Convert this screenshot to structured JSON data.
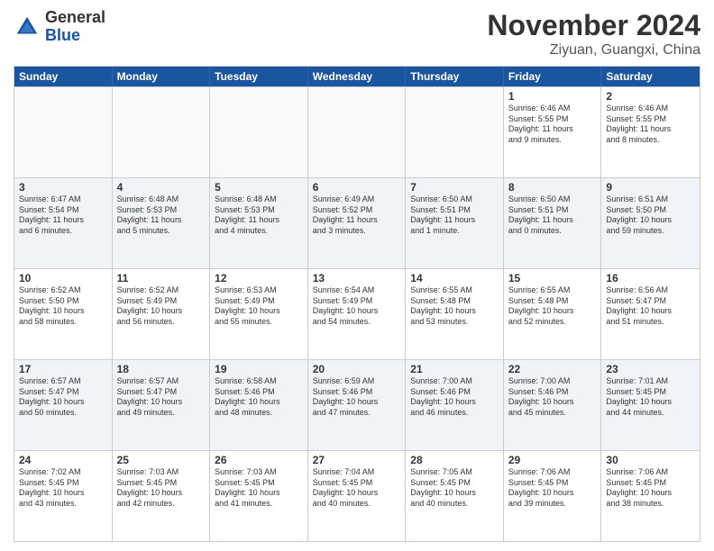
{
  "logo": {
    "line1": "General",
    "line2": "Blue"
  },
  "title": "November 2024",
  "location": "Ziyuan, Guangxi, China",
  "headers": [
    "Sunday",
    "Monday",
    "Tuesday",
    "Wednesday",
    "Thursday",
    "Friday",
    "Saturday"
  ],
  "rows": [
    [
      {
        "day": "",
        "info": ""
      },
      {
        "day": "",
        "info": ""
      },
      {
        "day": "",
        "info": ""
      },
      {
        "day": "",
        "info": ""
      },
      {
        "day": "",
        "info": ""
      },
      {
        "day": "1",
        "info": "Sunrise: 6:46 AM\nSunset: 5:55 PM\nDaylight: 11 hours\nand 9 minutes."
      },
      {
        "day": "2",
        "info": "Sunrise: 6:46 AM\nSunset: 5:55 PM\nDaylight: 11 hours\nand 8 minutes."
      }
    ],
    [
      {
        "day": "3",
        "info": "Sunrise: 6:47 AM\nSunset: 5:54 PM\nDaylight: 11 hours\nand 6 minutes."
      },
      {
        "day": "4",
        "info": "Sunrise: 6:48 AM\nSunset: 5:53 PM\nDaylight: 11 hours\nand 5 minutes."
      },
      {
        "day": "5",
        "info": "Sunrise: 6:48 AM\nSunset: 5:53 PM\nDaylight: 11 hours\nand 4 minutes."
      },
      {
        "day": "6",
        "info": "Sunrise: 6:49 AM\nSunset: 5:52 PM\nDaylight: 11 hours\nand 3 minutes."
      },
      {
        "day": "7",
        "info": "Sunrise: 6:50 AM\nSunset: 5:51 PM\nDaylight: 11 hours\nand 1 minute."
      },
      {
        "day": "8",
        "info": "Sunrise: 6:50 AM\nSunset: 5:51 PM\nDaylight: 11 hours\nand 0 minutes."
      },
      {
        "day": "9",
        "info": "Sunrise: 6:51 AM\nSunset: 5:50 PM\nDaylight: 10 hours\nand 59 minutes."
      }
    ],
    [
      {
        "day": "10",
        "info": "Sunrise: 6:52 AM\nSunset: 5:50 PM\nDaylight: 10 hours\nand 58 minutes."
      },
      {
        "day": "11",
        "info": "Sunrise: 6:52 AM\nSunset: 5:49 PM\nDaylight: 10 hours\nand 56 minutes."
      },
      {
        "day": "12",
        "info": "Sunrise: 6:53 AM\nSunset: 5:49 PM\nDaylight: 10 hours\nand 55 minutes."
      },
      {
        "day": "13",
        "info": "Sunrise: 6:54 AM\nSunset: 5:49 PM\nDaylight: 10 hours\nand 54 minutes."
      },
      {
        "day": "14",
        "info": "Sunrise: 6:55 AM\nSunset: 5:48 PM\nDaylight: 10 hours\nand 53 minutes."
      },
      {
        "day": "15",
        "info": "Sunrise: 6:55 AM\nSunset: 5:48 PM\nDaylight: 10 hours\nand 52 minutes."
      },
      {
        "day": "16",
        "info": "Sunrise: 6:56 AM\nSunset: 5:47 PM\nDaylight: 10 hours\nand 51 minutes."
      }
    ],
    [
      {
        "day": "17",
        "info": "Sunrise: 6:57 AM\nSunset: 5:47 PM\nDaylight: 10 hours\nand 50 minutes."
      },
      {
        "day": "18",
        "info": "Sunrise: 6:57 AM\nSunset: 5:47 PM\nDaylight: 10 hours\nand 49 minutes."
      },
      {
        "day": "19",
        "info": "Sunrise: 6:58 AM\nSunset: 5:46 PM\nDaylight: 10 hours\nand 48 minutes."
      },
      {
        "day": "20",
        "info": "Sunrise: 6:59 AM\nSunset: 5:46 PM\nDaylight: 10 hours\nand 47 minutes."
      },
      {
        "day": "21",
        "info": "Sunrise: 7:00 AM\nSunset: 5:46 PM\nDaylight: 10 hours\nand 46 minutes."
      },
      {
        "day": "22",
        "info": "Sunrise: 7:00 AM\nSunset: 5:46 PM\nDaylight: 10 hours\nand 45 minutes."
      },
      {
        "day": "23",
        "info": "Sunrise: 7:01 AM\nSunset: 5:45 PM\nDaylight: 10 hours\nand 44 minutes."
      }
    ],
    [
      {
        "day": "24",
        "info": "Sunrise: 7:02 AM\nSunset: 5:45 PM\nDaylight: 10 hours\nand 43 minutes."
      },
      {
        "day": "25",
        "info": "Sunrise: 7:03 AM\nSunset: 5:45 PM\nDaylight: 10 hours\nand 42 minutes."
      },
      {
        "day": "26",
        "info": "Sunrise: 7:03 AM\nSunset: 5:45 PM\nDaylight: 10 hours\nand 41 minutes."
      },
      {
        "day": "27",
        "info": "Sunrise: 7:04 AM\nSunset: 5:45 PM\nDaylight: 10 hours\nand 40 minutes."
      },
      {
        "day": "28",
        "info": "Sunrise: 7:05 AM\nSunset: 5:45 PM\nDaylight: 10 hours\nand 40 minutes."
      },
      {
        "day": "29",
        "info": "Sunrise: 7:06 AM\nSunset: 5:45 PM\nDaylight: 10 hours\nand 39 minutes."
      },
      {
        "day": "30",
        "info": "Sunrise: 7:06 AM\nSunset: 5:45 PM\nDaylight: 10 hours\nand 38 minutes."
      }
    ]
  ]
}
